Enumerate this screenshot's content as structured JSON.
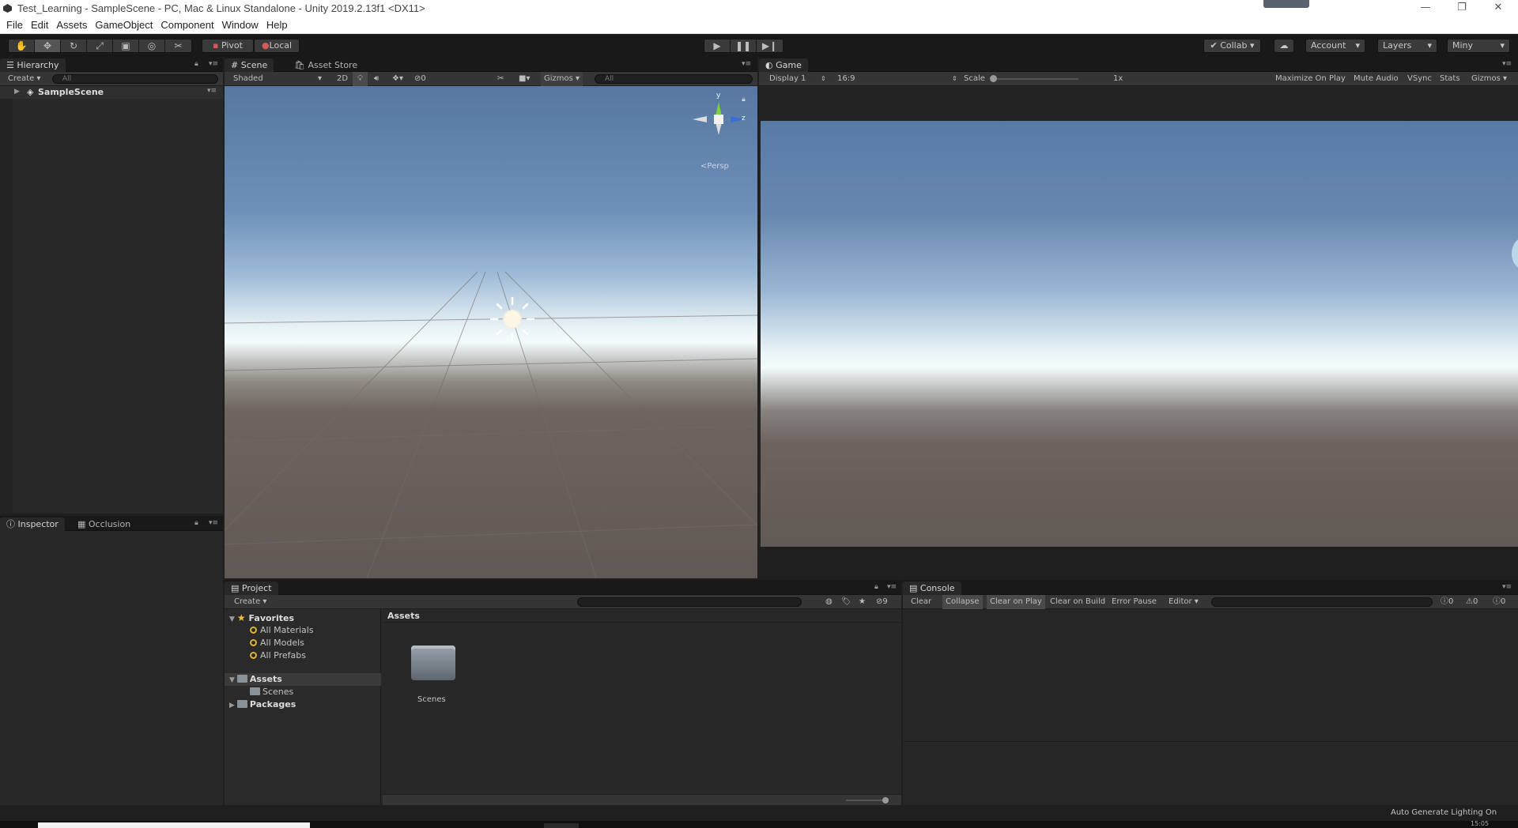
{
  "window": {
    "title": "Test_Learning - SampleScene - PC, Mac & Linux Standalone - Unity 2019.2.13f1 <DX11>",
    "minimize": "—",
    "restore": "❐",
    "close": "✕"
  },
  "menu": [
    "File",
    "Edit",
    "Assets",
    "GameObject",
    "Component",
    "Window",
    "Help"
  ],
  "toolbar": {
    "pivot": "Pivot",
    "local": "Local",
    "collab": "Collab",
    "account": "Account",
    "layers": "Layers",
    "layout": "Miny"
  },
  "hierarchy": {
    "tab": "Hierarchy",
    "create": "Create",
    "search_placeholder": "All",
    "scene": "SampleScene"
  },
  "inspector": {
    "tab1": "Inspector",
    "tab2": "Occlusion"
  },
  "scene": {
    "tab": "Scene",
    "tab2": "Asset Store",
    "shading": "Shaded",
    "mode2d": "2D",
    "hidden_count": "0",
    "gizmos": "Gizmos",
    "search_placeholder": "All",
    "gizmo_y": "y",
    "gizmo_z": "z",
    "persp": "Persp"
  },
  "game": {
    "tab": "Game",
    "display": "Display 1",
    "aspect": "16:9",
    "scale_label": "Scale",
    "scale_value": "1x",
    "maximize": "Maximize On Play",
    "mute": "Mute Audio",
    "vsync": "VSync",
    "stats": "Stats",
    "gizmos": "Gizmos"
  },
  "project": {
    "tab": "Project",
    "create": "Create",
    "hidden_count": "9",
    "favorites": "Favorites",
    "fav_items": [
      "All Materials",
      "All Models",
      "All Prefabs"
    ],
    "assets": "Assets",
    "scenes": "Scenes",
    "packages": "Packages",
    "breadcrumb": "Assets",
    "folder_label": "Scenes"
  },
  "console": {
    "tab": "Console",
    "clear": "Clear",
    "collapse": "Collapse",
    "clear_on_play": "Clear on Play",
    "clear_on_build": "Clear on Build",
    "error_pause": "Error Pause",
    "editor": "Editor",
    "info_count": "0",
    "warn_count": "0",
    "error_count": "0"
  },
  "status": {
    "lighting": "Auto Generate Lighting On",
    "clock": "15:05"
  },
  "colors": {
    "accent": "#3d7bd6",
    "gizmo_y": "#7bd23b",
    "gizmo_z": "#3b6fd2",
    "folder_star": "#f1c232"
  }
}
